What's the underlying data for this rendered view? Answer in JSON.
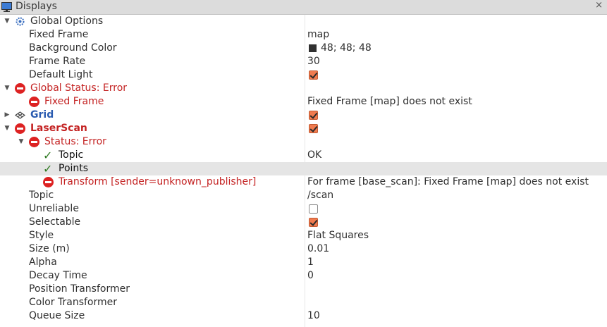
{
  "panel": {
    "title": "Displays",
    "close_label": "×"
  },
  "global_options": {
    "label": "Global Options",
    "fixed_frame": {
      "label": "Fixed Frame",
      "value": "map"
    },
    "background_color": {
      "label": "Background Color",
      "value": "48; 48; 48",
      "swatch": "#303030"
    },
    "frame_rate": {
      "label": "Frame Rate",
      "value": "30"
    },
    "default_light": {
      "label": "Default Light",
      "checked": true
    }
  },
  "global_status": {
    "label": "Global Status: Error",
    "fixed_frame": {
      "label": "Fixed Frame",
      "value": "Fixed Frame [map] does not exist"
    }
  },
  "grid": {
    "label": "Grid",
    "checked": true
  },
  "laserscan": {
    "label": "LaserScan",
    "checked": true,
    "status": {
      "label": "Status: Error",
      "topic": {
        "label": "Topic",
        "value": "OK"
      },
      "points": {
        "label": "Points",
        "value": ""
      },
      "transform": {
        "label": "Transform [sender=unknown_publisher]",
        "value": "For frame [base_scan]: Fixed Frame [map] does not exist"
      }
    },
    "props": {
      "topic": {
        "label": "Topic",
        "value": "/scan"
      },
      "unreliable": {
        "label": "Unreliable",
        "checked": false
      },
      "selectable": {
        "label": "Selectable",
        "checked": true
      },
      "style": {
        "label": "Style",
        "value": "Flat Squares"
      },
      "size": {
        "label": "Size (m)",
        "value": "0.01"
      },
      "alpha": {
        "label": "Alpha",
        "value": "1"
      },
      "decay_time": {
        "label": "Decay Time",
        "value": "0"
      },
      "position_transformer": {
        "label": "Position Transformer",
        "value": ""
      },
      "color_transformer": {
        "label": "Color Transformer",
        "value": ""
      },
      "queue_size": {
        "label": "Queue Size",
        "value": "10"
      }
    }
  },
  "colors": {
    "error": "#c42323",
    "grid_label": "#2a5bb0",
    "checkbox_on": "#f07b4f",
    "selected_row": "#e5e5e5"
  }
}
